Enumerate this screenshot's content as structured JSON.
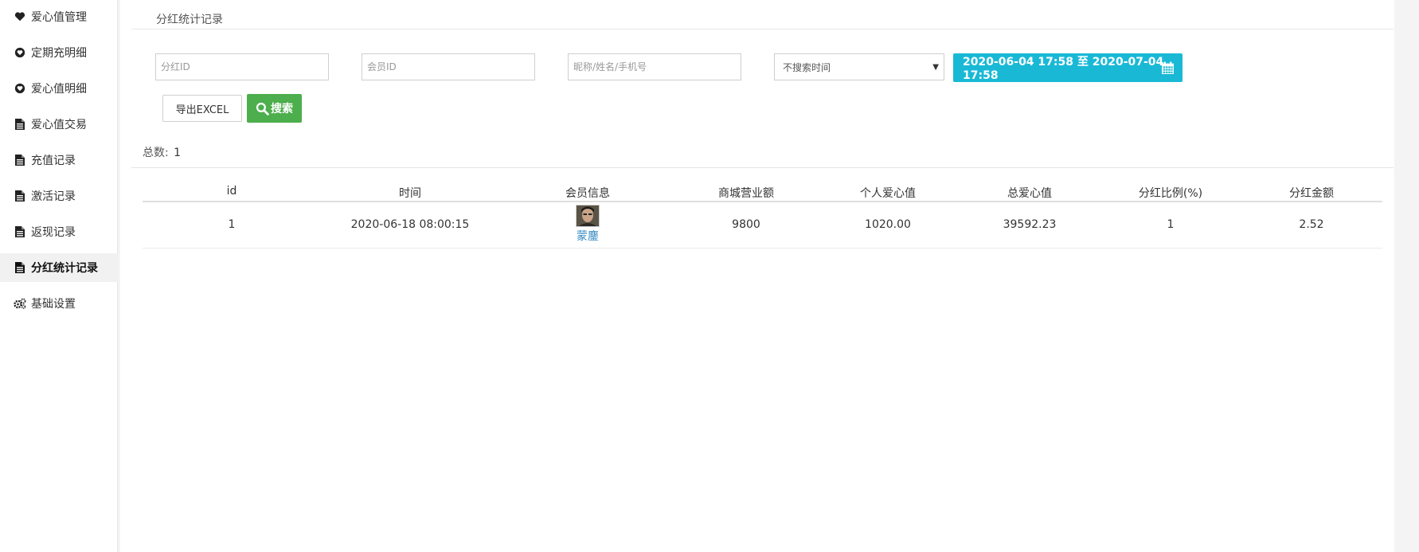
{
  "sidebar": {
    "items": [
      {
        "label": "爱心值管理",
        "icon": "heart-icon"
      },
      {
        "label": "定期充明细",
        "icon": "heart-circle-icon"
      },
      {
        "label": "爱心值明细",
        "icon": "heart-circle-icon"
      },
      {
        "label": "爱心值交易",
        "icon": "file-icon"
      },
      {
        "label": "充值记录",
        "icon": "file-icon"
      },
      {
        "label": "激活记录",
        "icon": "file-icon"
      },
      {
        "label": "返现记录",
        "icon": "file-icon"
      },
      {
        "label": "分红统计记录",
        "icon": "file-icon",
        "active": true
      },
      {
        "label": "基础设置",
        "icon": "cogs-icon"
      }
    ]
  },
  "page": {
    "title": "分红统计记录"
  },
  "filters": {
    "dividend_id_placeholder": "分红ID",
    "member_id_placeholder": "会员ID",
    "nickname_placeholder": "昵称/姓名/手机号",
    "time_select_value": "不搜索时间",
    "date_range": "2020-06-04 17:58 至 2020-07-04 17:58",
    "export_label": "导出EXCEL",
    "search_label": "搜索"
  },
  "summary": {
    "total_label": "总数:",
    "total_value": "1"
  },
  "table": {
    "headers": [
      "id",
      "时间",
      "会员信息",
      "商城营业额",
      "个人爱心值",
      "总爱心值",
      "分红比例(%)",
      "分红金额"
    ],
    "rows": [
      {
        "id": "1",
        "time": "2020-06-18 08:00:15",
        "member_name": "蒙鏖",
        "revenue": "9800",
        "personal_love": "1020.00",
        "total_love": "39592.23",
        "ratio": "1",
        "amount": "2.52"
      }
    ]
  },
  "colors": {
    "accent_cyan": "#19b9d6",
    "search_green": "#4cae4c",
    "link_blue": "#3a8ec5"
  }
}
